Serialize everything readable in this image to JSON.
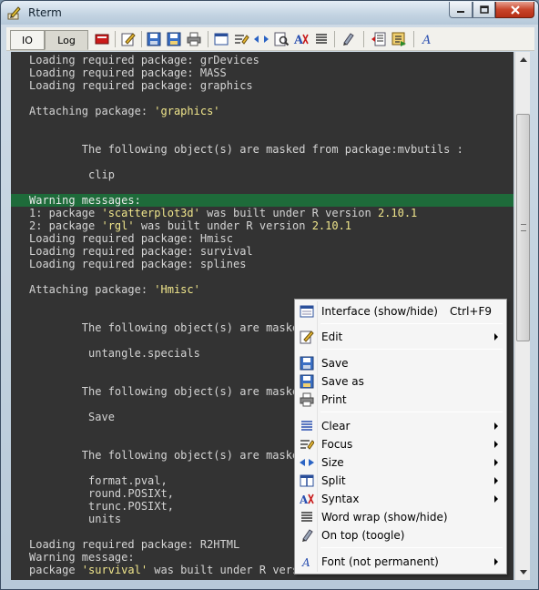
{
  "window": {
    "title": "Rterm"
  },
  "toolbar": {
    "tabs": [
      {
        "label": "IO"
      },
      {
        "label": "Log"
      }
    ]
  },
  "console": {
    "lines": [
      {
        "text": "Loading required package: grDevices"
      },
      {
        "text": "Loading required package: MASS"
      },
      {
        "text": "Loading required package: graphics"
      },
      {
        "text": ""
      },
      {
        "text": "Attaching package: 'graphics'"
      },
      {
        "text": ""
      },
      {
        "text": ""
      },
      {
        "text": "        The following object(s) are masked from package:mvbutils :"
      },
      {
        "text": ""
      },
      {
        "text": "         clip"
      },
      {
        "text": ""
      },
      {
        "text": "Warning messages:"
      },
      {
        "text": "1: package 'scatterplot3d' was built under R version 2.10.1"
      },
      {
        "text": "2: package 'rgl' was built under R version 2.10.1"
      },
      {
        "text": "Loading required package: Hmisc"
      },
      {
        "text": "Loading required package: survival"
      },
      {
        "text": "Loading required package: splines"
      },
      {
        "text": ""
      },
      {
        "text": "Attaching package: 'Hmisc'"
      },
      {
        "text": ""
      },
      {
        "text": ""
      },
      {
        "text": "        The following object(s) are masked"
      },
      {
        "text": ""
      },
      {
        "text": "         untangle.specials"
      },
      {
        "text": ""
      },
      {
        "text": ""
      },
      {
        "text": "        The following object(s) are masked"
      },
      {
        "text": ""
      },
      {
        "text": "         Save"
      },
      {
        "text": ""
      },
      {
        "text": ""
      },
      {
        "text": "        The following object(s) are masked"
      },
      {
        "text": ""
      },
      {
        "text": "         format.pval,"
      },
      {
        "text": "         round.POSIXt,"
      },
      {
        "text": "         trunc.POSIXt,"
      },
      {
        "text": "         units"
      },
      {
        "text": ""
      },
      {
        "text": "Loading required package: R2HTML"
      },
      {
        "text": "Warning message:"
      },
      {
        "text": "package 'survival' was built under R versi"
      }
    ],
    "warning_line_index": 11
  },
  "context_menu": {
    "items": [
      {
        "label": "Interface (show/hide)",
        "shortcut": "Ctrl+F9",
        "icon": "interface-icon",
        "submenu": false
      },
      {
        "label": "Edit",
        "shortcut": "",
        "icon": "edit-icon",
        "submenu": true
      },
      {
        "label": "Save",
        "shortcut": "",
        "icon": "save-icon",
        "submenu": false
      },
      {
        "label": "Save as",
        "shortcut": "",
        "icon": "save-as-icon",
        "submenu": false
      },
      {
        "label": "Print",
        "shortcut": "",
        "icon": "print-icon",
        "submenu": false
      },
      {
        "label": "Clear",
        "shortcut": "",
        "icon": "clear-icon",
        "submenu": true
      },
      {
        "label": "Focus",
        "shortcut": "",
        "icon": "focus-icon",
        "submenu": true
      },
      {
        "label": "Size",
        "shortcut": "",
        "icon": "size-icon",
        "submenu": true
      },
      {
        "label": "Split",
        "shortcut": "",
        "icon": "split-icon",
        "submenu": true
      },
      {
        "label": "Syntax",
        "shortcut": "",
        "icon": "syntax-icon",
        "submenu": true
      },
      {
        "label": "Word wrap (show/hide)",
        "shortcut": "",
        "icon": "word-wrap-icon",
        "submenu": false
      },
      {
        "label": "On top (toogle)",
        "shortcut": "",
        "icon": "on-top-icon",
        "submenu": false
      },
      {
        "label": "Font (not permanent)",
        "shortcut": "",
        "icon": "font-icon",
        "submenu": true
      }
    ]
  },
  "colors": {
    "console_bg": "#333333",
    "console_text": "#d4d4d4",
    "warning_bg": "#1e6b3a",
    "string_text": "#f0e68c",
    "menu_bg": "#f5f5f5"
  }
}
